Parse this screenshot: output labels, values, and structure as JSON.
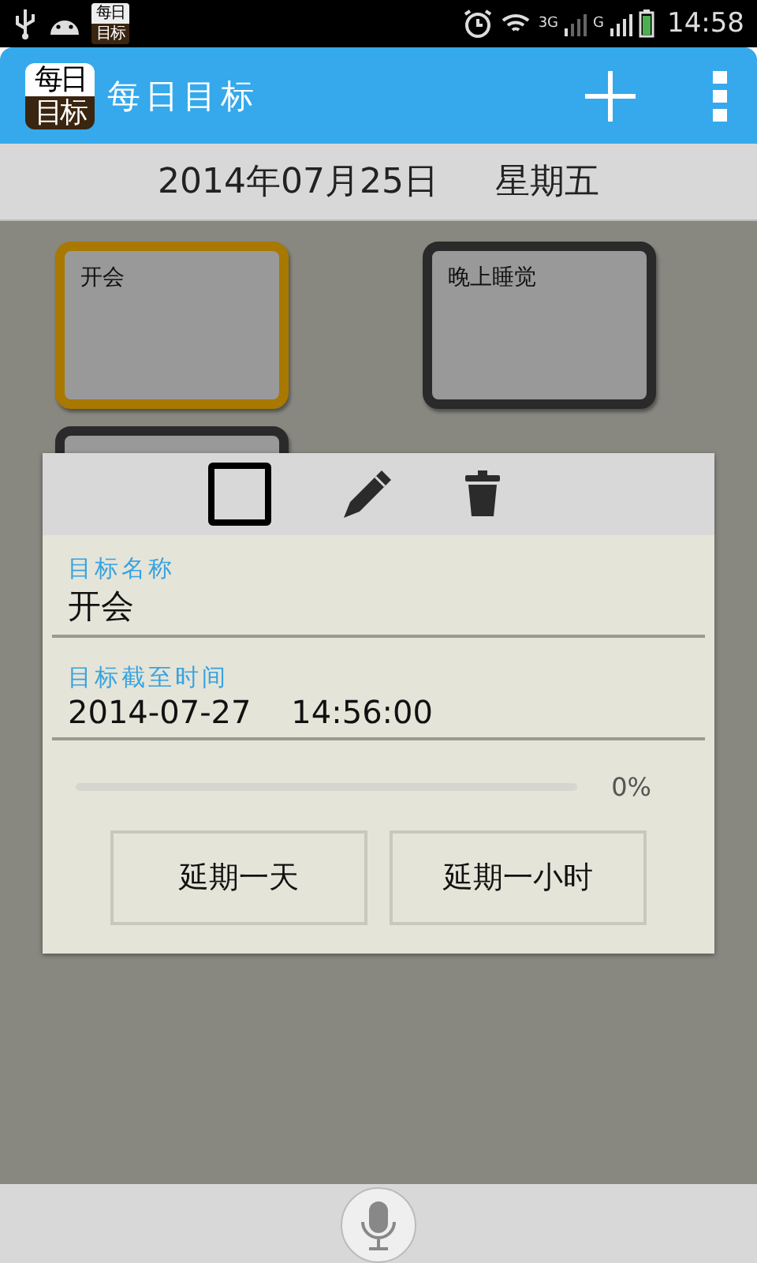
{
  "status_bar": {
    "app_icon_lines": [
      "每日",
      "目标"
    ],
    "network_1": "3G",
    "network_2": "G",
    "time": "14:58"
  },
  "app_bar": {
    "logo_lines": [
      "每日",
      "目标"
    ],
    "title": "每日目标"
  },
  "date_bar": {
    "date": "2014年07月25日",
    "weekday": "星期五"
  },
  "cards": [
    {
      "label": "开会",
      "selected": true
    },
    {
      "label": "晚上睡觉",
      "selected": false
    },
    {
      "selected": false
    }
  ],
  "dialog": {
    "done": {
      "checked": false
    },
    "fields": [
      {
        "label": "目标名称",
        "value": "开会",
        "kind": "name"
      },
      {
        "label": "目标截至时间",
        "value": "2014-07-27    14:56:00",
        "kind": "datetime"
      }
    ],
    "progress": {
      "level": 0,
      "reading": "0%"
    },
    "buttons": [
      "延期一天",
      "延期一小时"
    ]
  }
}
